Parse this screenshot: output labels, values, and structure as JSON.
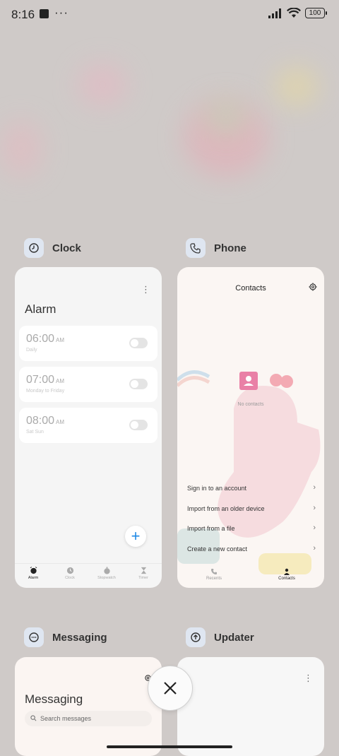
{
  "status": {
    "time": "8:16",
    "more": "···",
    "battery": "100"
  },
  "cards": {
    "clock": {
      "app_name": "Clock",
      "header_title": "Alarm",
      "alarms": [
        {
          "time": "06:00",
          "ampm": "AM",
          "repeat": "Daily"
        },
        {
          "time": "07:00",
          "ampm": "AM",
          "repeat": "Monday to Friday"
        },
        {
          "time": "08:00",
          "ampm": "AM",
          "repeat": "Sat Sun"
        }
      ],
      "tabs": [
        "Alarm",
        "Clock",
        "Stopwatch",
        "Timer"
      ],
      "accent": "#1e88e5"
    },
    "phone": {
      "app_name": "Phone",
      "header_title": "Contacts",
      "empty_text": "No contacts",
      "options": [
        "Sign in to an account",
        "Import from an older device",
        "Import from a file",
        "Create a new contact"
      ],
      "tabs": [
        "Recents",
        "Contacts"
      ]
    },
    "messaging": {
      "app_name": "Messaging",
      "header_title": "Messaging",
      "search_placeholder": "Search messages"
    },
    "updater": {
      "app_name": "Updater"
    }
  },
  "icons": {
    "clock_app": "clock-icon",
    "phone_app": "phone-icon",
    "messaging_app": "chat-bubble-icon",
    "updater_app": "upload-arrow-icon",
    "close": "close-icon"
  }
}
